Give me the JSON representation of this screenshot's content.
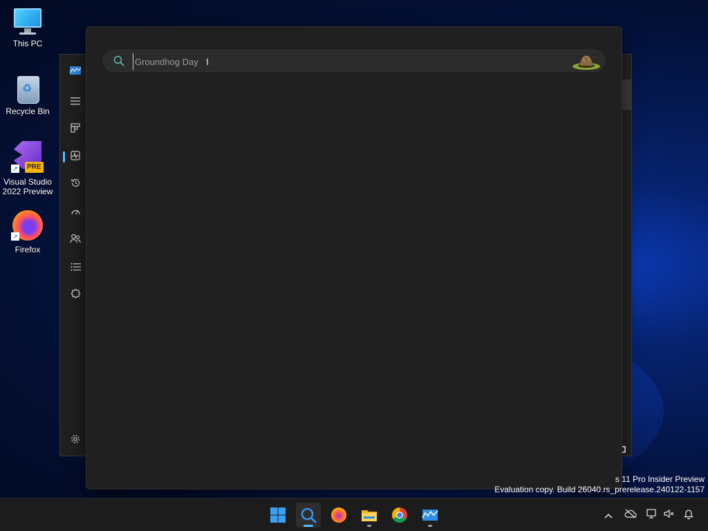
{
  "desktop": {
    "icons": [
      {
        "label": "This PC"
      },
      {
        "label": "Recycle Bin"
      },
      {
        "label": "Visual Studio 2022 Preview",
        "badge": "PRE"
      },
      {
        "label": "Firefox"
      }
    ]
  },
  "search": {
    "placeholder": "Groundhog Day",
    "value": ""
  },
  "watermark": {
    "line1": "s 11 Pro Insider Preview",
    "line2": "Evaluation copy. Build 26040.rs_prerelease.240122-1157"
  },
  "sidebar": {
    "items": [
      "app-logo-icon",
      "menu-icon",
      "dashboard-icon",
      "activity-icon",
      "history-icon",
      "speedometer-icon",
      "users-icon",
      "list-icon",
      "puzzle-icon",
      "settings-icon"
    ]
  },
  "taskbar": {
    "apps": [
      "start-icon",
      "search-icon",
      "firefox-icon",
      "file-explorer-icon",
      "chrome-icon",
      "app-icon"
    ],
    "tray": [
      "chevron-up-icon",
      "cloud-off-icon",
      "network-icon",
      "volume-mute-icon",
      "bell-icon"
    ]
  },
  "colors": {
    "accent": "#4cc2ff",
    "panel": "#202020",
    "taskbar": "#1c1c1c"
  }
}
